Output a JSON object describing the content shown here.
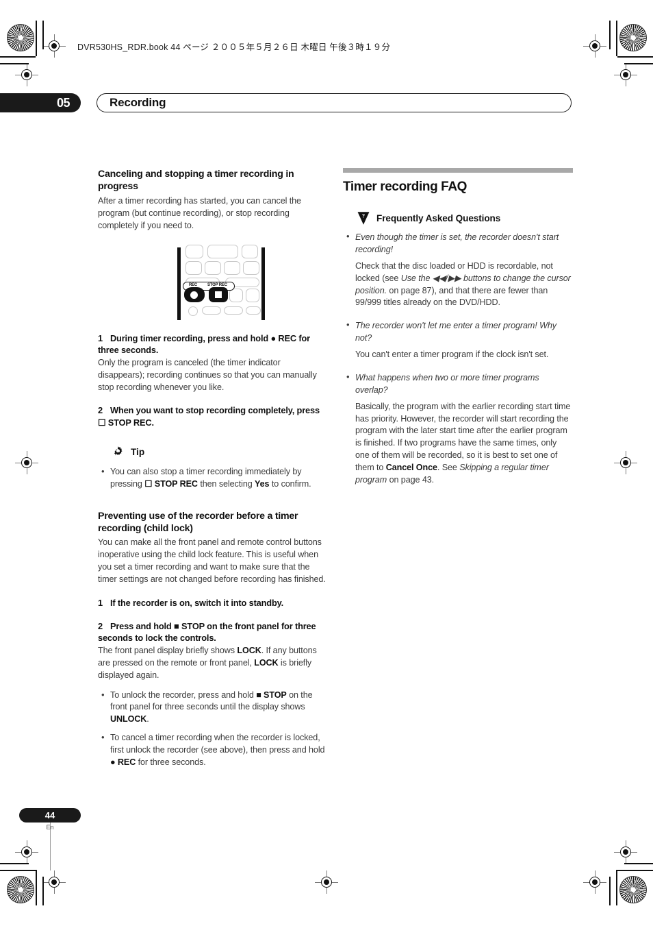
{
  "print": {
    "book_info": "DVR530HS_RDR.book  44 ページ  ２００５年５月２６日  木曜日  午後３時１９分"
  },
  "chapter": {
    "number": "05",
    "title": "Recording"
  },
  "left_column": {
    "section1": {
      "heading": "Canceling and stopping a timer recording in progress",
      "intro": "After a timer recording has started, you can cancel the program (but continue recording), or stop recording completely if you need to.",
      "remote_diagram": {
        "label_rec": "REC",
        "label_stop_rec": "STOP REC"
      },
      "step1_num": "1",
      "step1_text": "During timer recording, press and hold ● REC for three seconds.",
      "step1_body": "Only the program is canceled (the timer indicator disappears); recording continues so that you can manually stop recording whenever you like.",
      "step2_num": "2",
      "step2_text": "When you want to stop recording completely, press ☐ STOP REC.",
      "tip_label": "Tip",
      "tip_bullet": "You can also stop a timer recording immediately by pressing ☐ STOP REC then selecting Yes to confirm."
    },
    "section2": {
      "heading": "Preventing use of the recorder before a timer recording (child lock)",
      "intro": "You can make all the front panel and remote control buttons inoperative using the child lock feature. This is useful when you set a timer recording and want to make sure that the timer settings are not changed before recording has finished.",
      "step1_num": "1",
      "step1_text": "If the recorder is on, switch it into standby.",
      "step2_num": "2",
      "step2_text": "Press and hold ■ STOP on the front panel for three seconds to lock the controls.",
      "step2_body": "The front panel display briefly shows LOCK. If any buttons are pressed on the remote or front panel, LOCK is briefly displayed again.",
      "bullet1": "To unlock the recorder, press and hold ■ STOP on the front panel for three seconds until the display shows UNLOCK.",
      "bullet2": "To cancel a timer recording when the recorder is locked, first unlock the recorder (see above), then press and hold ● REC for three seconds."
    }
  },
  "right_column": {
    "title": "Timer recording FAQ",
    "faq_label": "Frequently Asked Questions",
    "items": [
      {
        "question": "Even though the timer is set, the recorder doesn't start recording!",
        "answer": "Check that the disc loaded or HDD is recordable, not locked (see Use the ◀◀/▶▶ buttons to change the cursor position. on page 87), and that there are fewer than 99/999 titles already on the DVD/HDD."
      },
      {
        "question": "The recorder won't let me enter a timer program! Why not?",
        "answer": "You can't enter a timer program if the clock isn't set."
      },
      {
        "question": "What happens when two or more timer programs overlap?",
        "answer": "Basically, the program with the earlier recording start time has priority. However, the recorder will start recording the program with the later start time after the earlier program is finished. If two programs have the same times, only one of them will be recorded, so it is best to set one of them to Cancel Once. See Skipping a regular timer program on page 43."
      }
    ]
  },
  "footer": {
    "page_number": "44",
    "language": "En"
  }
}
